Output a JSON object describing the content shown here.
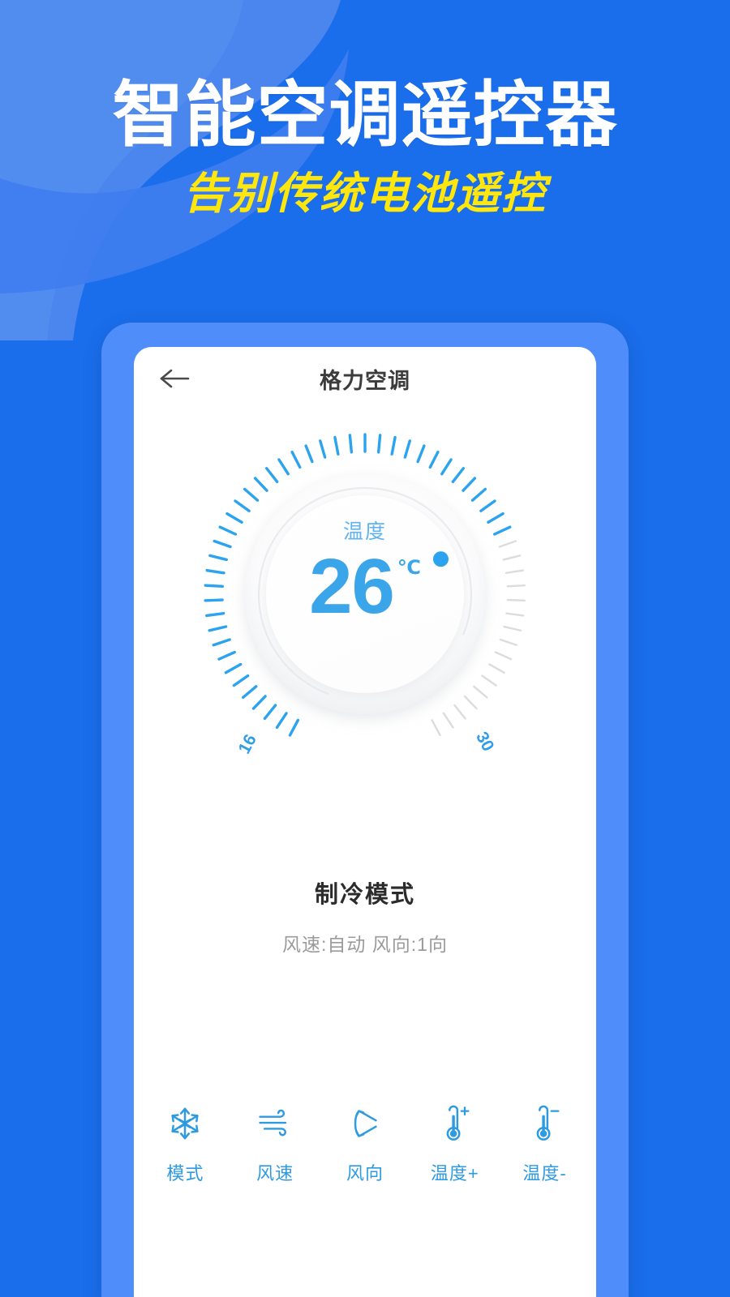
{
  "theme": {
    "bg_blue": "#1a6deb",
    "wave_blue_light": "#4b85ee",
    "wave_blue_light2": "#3f7df0",
    "phone_frame_blue": "#4f8dfa",
    "accent_blue": "#3aa5e8",
    "tick_active_blue": "#2ba3ee",
    "tick_inactive_gray": "#dcdcdc",
    "title_white": "#ffffff",
    "subtitle_yellow": "#ffe70d"
  },
  "hero": {
    "title": "智能空调遥控器",
    "subtitle": "告别传统电池遥控"
  },
  "appbar": {
    "back_icon": "arrow-left-icon",
    "title": "格力空调"
  },
  "dial": {
    "label": "温度",
    "value": "26",
    "unit": "℃",
    "min_label": "16",
    "max_label": "30",
    "min": 16,
    "max": 30,
    "current": 26,
    "tick_count": 57,
    "indicator_dot": "temperature-indicator-dot"
  },
  "status": {
    "mode_name": "制冷模式",
    "detail": "风速:自动 风向:1向"
  },
  "controls": [
    {
      "icon": "snowflake-icon",
      "label": "模式"
    },
    {
      "icon": "wind-icon",
      "label": "风速"
    },
    {
      "icon": "swing-direction-icon",
      "label": "风向"
    },
    {
      "icon": "thermometer-plus-icon",
      "label": "温度+"
    },
    {
      "icon": "thermometer-minus-icon",
      "label": "温度-"
    }
  ]
}
